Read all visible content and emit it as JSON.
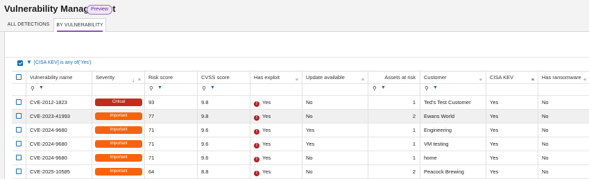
{
  "app": {
    "title": "Vulnerability Management",
    "badge": "Preview"
  },
  "tabs": [
    {
      "label": "ALL DETECTIONS",
      "active": false
    },
    {
      "label": "BY VULNERABILITY",
      "active": true
    }
  ],
  "filter": {
    "text": "[CISA KEV] is any of('Yes')",
    "checked": true,
    "icon": "filter-icon"
  },
  "columns": [
    {
      "label": "Vulnerability name",
      "filter": true
    },
    {
      "label": "Severity",
      "sorted": "desc",
      "filter": true
    },
    {
      "label": "Risk score",
      "filter": false
    },
    {
      "label": "CVSS score",
      "filter": false
    },
    {
      "label": "Has exploit",
      "filter": true
    },
    {
      "label": "Update available",
      "filter": true
    },
    {
      "label": "Assets at risk",
      "filter": false
    },
    {
      "label": "Customer",
      "filter": true
    },
    {
      "label": "CISA KEV",
      "filter": true,
      "filter_active": true
    },
    {
      "label": "Has ransomware",
      "filter": true
    }
  ],
  "severity_colors": {
    "Critical": "#c42b1c",
    "Important": "#f7630c"
  },
  "rows": [
    {
      "name": "CVE-2012-1823",
      "severity": "Critical",
      "risk": "93",
      "cvss": "9.8",
      "exploit": "Yes",
      "update": "No",
      "assets": "1",
      "customer": "Ted's Test Customer",
      "kev": "Yes",
      "ransomware": "No"
    },
    {
      "name": "CVE-2023-41993",
      "severity": "Important",
      "risk": "77",
      "cvss": "9.8",
      "exploit": "Yes",
      "update": "No",
      "assets": "2",
      "customer": "Ewans World",
      "kev": "Yes",
      "ransomware": "No"
    },
    {
      "name": "CVE-2024-9680",
      "severity": "Important",
      "risk": "71",
      "cvss": "9.6",
      "exploit": "Yes",
      "update": "Yes",
      "assets": "1",
      "customer": "Engineering",
      "kev": "Yes",
      "ransomware": "No"
    },
    {
      "name": "CVE-2024-9680",
      "severity": "Important",
      "risk": "71",
      "cvss": "9.6",
      "exploit": "Yes",
      "update": "Yes",
      "assets": "1",
      "customer": "VM testing",
      "kev": "Yes",
      "ransomware": "No"
    },
    {
      "name": "CVE-2024-9680",
      "severity": "Important",
      "risk": "71",
      "cvss": "9.6",
      "exploit": "Yes",
      "update": "No",
      "assets": "1",
      "customer": "home",
      "kev": "Yes",
      "ransomware": "No"
    },
    {
      "name": "CVE-2025-10585",
      "severity": "Important",
      "risk": "64",
      "cvss": "8.8",
      "exploit": "Yes",
      "update": "No",
      "assets": "2",
      "customer": "Peacock Brewing",
      "kev": "Yes",
      "ransomware": "No"
    }
  ]
}
